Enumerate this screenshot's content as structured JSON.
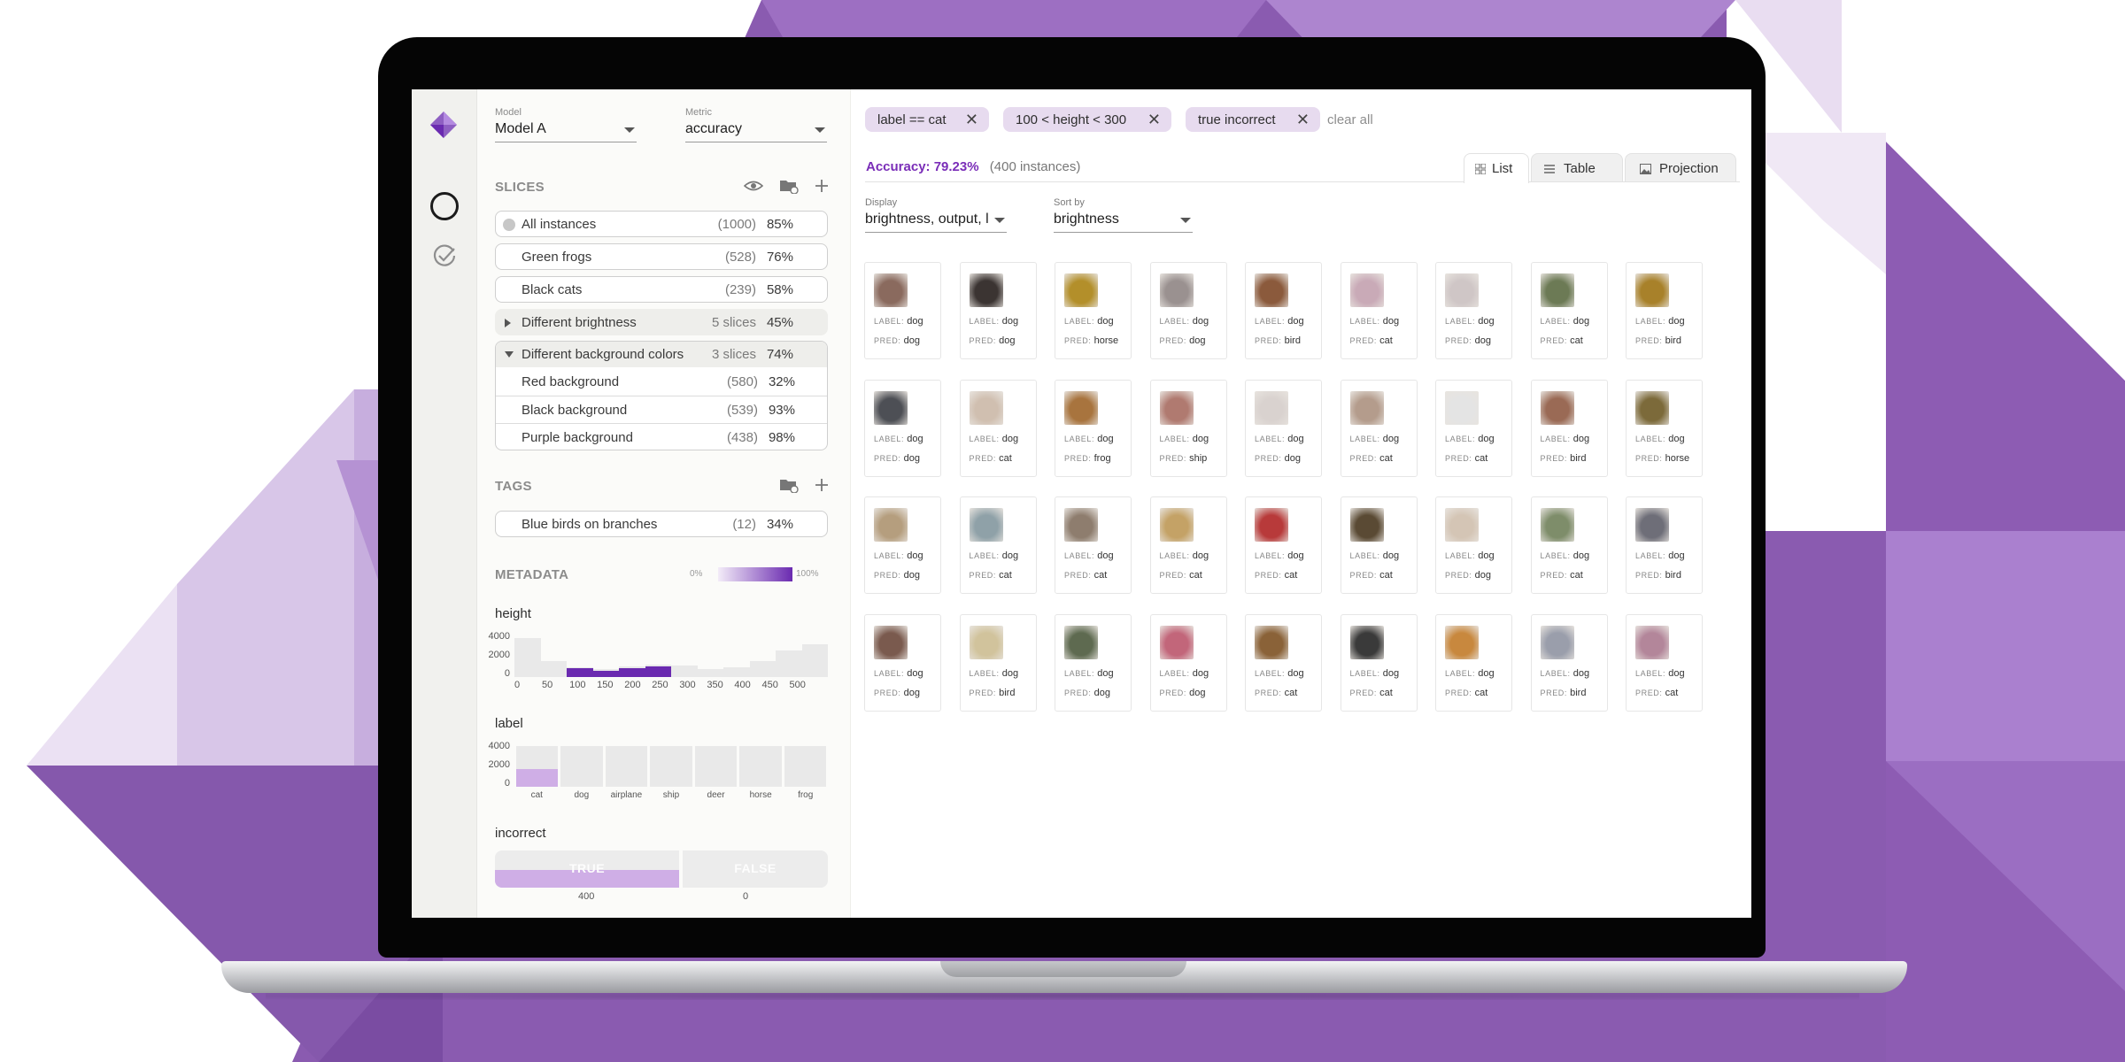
{
  "sidebar": {
    "model": {
      "caption": "Model",
      "value": "Model A"
    },
    "metric": {
      "caption": "Metric",
      "value": "accuracy"
    },
    "slices_title": "SLICES",
    "slices": [
      {
        "name": "All instances",
        "count": "(1000)",
        "pct": "85%"
      },
      {
        "name": "Green frogs",
        "count": "(528)",
        "pct": "76%"
      },
      {
        "name": "Black cats",
        "count": "(239)",
        "pct": "58%"
      }
    ],
    "groups": [
      {
        "name": "Different brightness",
        "subcount": "5 slices",
        "pct": "45%",
        "expanded": false
      },
      {
        "name": "Different background colors",
        "subcount": "3 slices",
        "pct": "74%",
        "expanded": true,
        "children": [
          {
            "name": "Red background",
            "count": "(580)",
            "pct": "32%"
          },
          {
            "name": "Black background",
            "count": "(539)",
            "pct": "93%"
          },
          {
            "name": "Purple background",
            "count": "(438)",
            "pct": "98%"
          }
        ]
      }
    ],
    "tags_title": "TAGS",
    "tags": [
      {
        "name": "Blue birds on branches",
        "count": "(12)",
        "pct": "34%"
      }
    ],
    "metadata_title": "METADATA",
    "legend": {
      "min": "0%",
      "max": "100%"
    },
    "height_hist": {
      "label": "height",
      "y_ticks": [
        "4000",
        "2000",
        "0"
      ],
      "x_ticks": [
        "0",
        "50",
        "100",
        "150",
        "200",
        "250",
        "300",
        "350",
        "400",
        "450",
        "500"
      ],
      "totals": [
        4200,
        1700,
        1100,
        850,
        1150,
        1350,
        1250,
        850,
        1050,
        1700,
        2900,
        3600
      ],
      "selected": [
        0,
        0,
        950,
        650,
        950,
        1150,
        0,
        0,
        0,
        0,
        0,
        0
      ],
      "max": 5000
    },
    "label_hist": {
      "label": "label",
      "y_ticks": [
        "4000",
        "2000",
        "0"
      ],
      "categories": [
        "cat",
        "dog",
        "airplane",
        "ship",
        "deer",
        "horse",
        "frog"
      ],
      "totals": [
        4000,
        4000,
        4000,
        4000,
        4000,
        4000,
        4000
      ],
      "selected": [
        1700,
        0,
        0,
        0,
        0,
        0,
        0
      ],
      "max": 4000
    },
    "incorrect": {
      "label": "incorrect",
      "true_label": "TRUE",
      "false_label": "FALSE",
      "true_count": "400",
      "false_count": "0",
      "true_selected_fraction": 1.0
    }
  },
  "filters": [
    {
      "label": "label == cat"
    },
    {
      "label": "100 < height < 300"
    },
    {
      "label": "true incorrect"
    }
  ],
  "clear_all": "clear all",
  "summary": {
    "accuracy": "Accuracy: 79.23%",
    "instances": "(400 instances)"
  },
  "tabs": [
    {
      "label": "List",
      "active": true
    },
    {
      "label": "Table",
      "active": false
    },
    {
      "label": "Projection",
      "active": false
    }
  ],
  "display": {
    "caption": "Display",
    "value": "brightness, output, l"
  },
  "sort": {
    "caption": "Sort by",
    "value": "brightness"
  },
  "card_keys": {
    "label": "LABEL:",
    "pred": "PRED:"
  },
  "instances": [
    {
      "label": "dog",
      "pred": "dog",
      "color": "#8a6a5e"
    },
    {
      "label": "dog",
      "pred": "dog",
      "color": "#3b3432"
    },
    {
      "label": "dog",
      "pred": "horse",
      "color": "#b38f2a"
    },
    {
      "label": "dog",
      "pred": "dog",
      "color": "#9a9190"
    },
    {
      "label": "dog",
      "pred": "bird",
      "color": "#8b5a3c"
    },
    {
      "label": "dog",
      "pred": "cat",
      "color": "#c9aab7"
    },
    {
      "label": "dog",
      "pred": "dog",
      "color": "#cfc6c6"
    },
    {
      "label": "dog",
      "pred": "cat",
      "color": "#6c7a55"
    },
    {
      "label": "dog",
      "pred": "bird",
      "color": "#a8812a"
    },
    {
      "label": "dog",
      "pred": "dog",
      "color": "#4d4f55"
    },
    {
      "label": "dog",
      "pred": "cat",
      "color": "#d0bfb0"
    },
    {
      "label": "dog",
      "pred": "frog",
      "color": "#a8743e"
    },
    {
      "label": "dog",
      "pred": "ship",
      "color": "#b07a70"
    },
    {
      "label": "dog",
      "pred": "dog",
      "color": "#d9d2cf"
    },
    {
      "label": "dog",
      "pred": "cat",
      "color": "#b49c8c"
    },
    {
      "label": "dog",
      "pred": "cat",
      "color": "#e4e4e4"
    },
    {
      "label": "dog",
      "pred": "bird",
      "color": "#9a6a55"
    },
    {
      "label": "dog",
      "pred": "horse",
      "color": "#7c6a3a"
    },
    {
      "label": "dog",
      "pred": "dog",
      "color": "#b59e7e"
    },
    {
      "label": "dog",
      "pred": "cat",
      "color": "#8fa1a8"
    },
    {
      "label": "dog",
      "pred": "cat",
      "color": "#8e7d6e"
    },
    {
      "label": "dog",
      "pred": "cat",
      "color": "#c4a266"
    },
    {
      "label": "dog",
      "pred": "cat",
      "color": "#b83a3a"
    },
    {
      "label": "dog",
      "pred": "cat",
      "color": "#5a4a34"
    },
    {
      "label": "dog",
      "pred": "dog",
      "color": "#d4c5b5"
    },
    {
      "label": "dog",
      "pred": "cat",
      "color": "#7e8d6a"
    },
    {
      "label": "dog",
      "pred": "bird",
      "color": "#6e6e78"
    },
    {
      "label": "dog",
      "pred": "dog",
      "color": "#7a5a4e"
    },
    {
      "label": "dog",
      "pred": "bird",
      "color": "#d1c39c"
    },
    {
      "label": "dog",
      "pred": "dog",
      "color": "#5e6a50"
    },
    {
      "label": "dog",
      "pred": "dog",
      "color": "#c2667a"
    },
    {
      "label": "dog",
      "pred": "cat",
      "color": "#8a6238"
    },
    {
      "label": "dog",
      "pred": "cat",
      "color": "#3a3a3a"
    },
    {
      "label": "dog",
      "pred": "cat",
      "color": "#c8883e"
    },
    {
      "label": "dog",
      "pred": "bird",
      "color": "#9a9eab"
    },
    {
      "label": "dog",
      "pred": "cat",
      "color": "#b3869a"
    }
  ],
  "colors": {
    "accent": "#7a2db8",
    "chip": "#e7dbef",
    "hist_selected": "#6a2ab0",
    "hist_light": "#cfaee6"
  }
}
